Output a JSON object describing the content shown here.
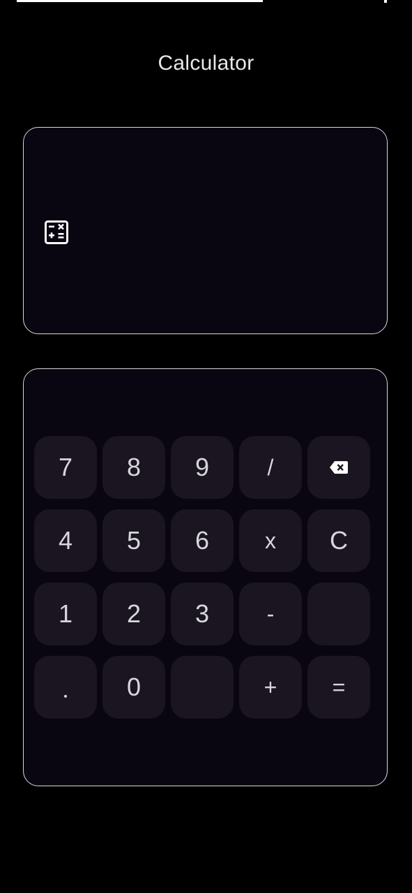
{
  "app": {
    "title": "Calculator"
  },
  "display": {
    "icon": "calculator-icon",
    "value": ""
  },
  "keypad": {
    "rows": [
      [
        {
          "label": "7",
          "name": "key-7"
        },
        {
          "label": "8",
          "name": "key-8"
        },
        {
          "label": "9",
          "name": "key-9"
        },
        {
          "label": "/",
          "name": "key-divide"
        },
        {
          "label": "",
          "name": "key-backspace",
          "icon": "backspace-icon"
        }
      ],
      [
        {
          "label": "4",
          "name": "key-4"
        },
        {
          "label": "5",
          "name": "key-5"
        },
        {
          "label": "6",
          "name": "key-6"
        },
        {
          "label": "x",
          "name": "key-multiply"
        },
        {
          "label": "C",
          "name": "key-clear"
        }
      ],
      [
        {
          "label": "1",
          "name": "key-1"
        },
        {
          "label": "2",
          "name": "key-2"
        },
        {
          "label": "3",
          "name": "key-3"
        },
        {
          "label": "-",
          "name": "key-subtract"
        },
        {
          "label": "",
          "name": "key-blank-1"
        }
      ],
      [
        {
          "label": ".",
          "name": "key-decimal"
        },
        {
          "label": "0",
          "name": "key-0"
        },
        {
          "label": "",
          "name": "key-blank-2"
        },
        {
          "label": "+",
          "name": "key-add"
        },
        {
          "label": "=",
          "name": "key-equals"
        }
      ]
    ]
  },
  "colors": {
    "background": "#000000",
    "card": "#090611",
    "card_border": "#d9d9de",
    "key": "#1a1520",
    "key_text": "#d7d6dc"
  }
}
